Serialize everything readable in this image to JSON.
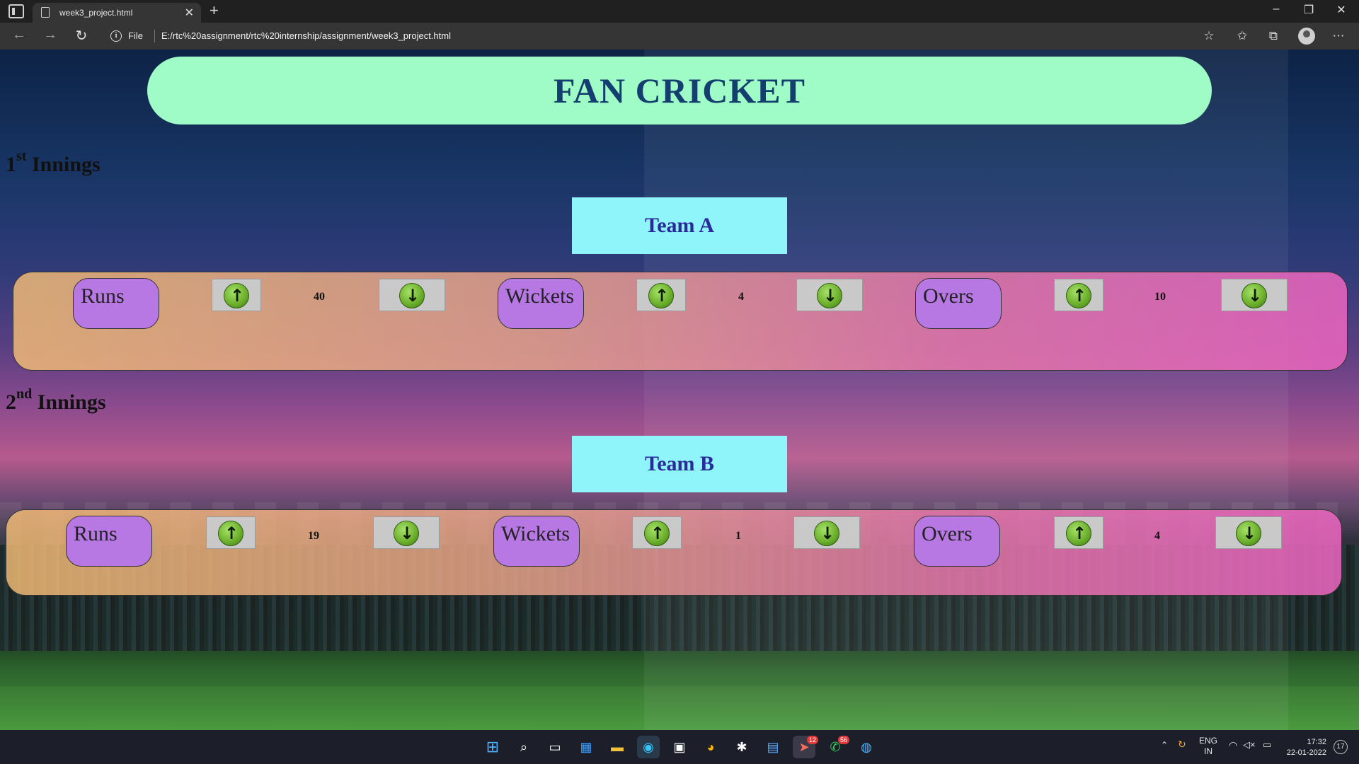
{
  "browser": {
    "tab_title": "week3_project.html",
    "scheme_label": "File",
    "url": "E:/rtc%20assignment/rtc%20internship/assignment/week3_project.html"
  },
  "page": {
    "heading": "FAN CRICKET",
    "innings": [
      {
        "ordinal": "1",
        "suffix": "st",
        "label": "Innings",
        "team": "Team A",
        "stats": [
          {
            "label": "Runs",
            "value": "40"
          },
          {
            "label": "Wickets",
            "value": "4"
          },
          {
            "label": "Overs",
            "value": "10"
          }
        ]
      },
      {
        "ordinal": "2",
        "suffix": "nd",
        "label": "Innings",
        "team": "Team B",
        "stats": [
          {
            "label": "Runs",
            "value": "19"
          },
          {
            "label": "Wickets",
            "value": "1"
          },
          {
            "label": "Overs",
            "value": "4"
          }
        ]
      }
    ],
    "colors": {
      "header_bg": "#9ffcc6",
      "header_text": "#143e6f",
      "team_box_bg": "#8ff5fb",
      "stat_pill_bg": "#b878e4",
      "arrow_green": "#6fb22e"
    }
  },
  "taskbar": {
    "language": "ENG",
    "region": "IN",
    "time": "17:32",
    "date": "22-01-2022",
    "notifications": "17",
    "badges": {
      "telegram": "12",
      "whatsapp": "56"
    }
  }
}
